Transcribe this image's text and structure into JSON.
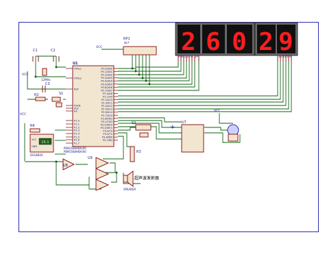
{
  "components": {
    "rp1": {
      "ref": "RP1",
      "value": "4k7"
    },
    "u1": {
      "ref": "U1",
      "part": "P89C668HBA/00",
      "subpart": "P89C668HBA/00"
    },
    "u7": {
      "ref": "U7"
    },
    "u8": {
      "ref": "U8"
    },
    "u9": {
      "ref": "U9"
    },
    "c1": {
      "ref": "C1"
    },
    "c2": {
      "ref": "C2"
    },
    "c3": {
      "ref": "C3"
    },
    "r2": {
      "ref": "R2"
    },
    "r3": {
      "ref": "R3"
    },
    "r6": {
      "ref": "R6"
    },
    "s1": {
      "ref": "S1"
    },
    "s2": {
      "ref": "S2"
    },
    "x1": {
      "value": "12MHz"
    },
    "ds18b20": {
      "ref": "DS18B20",
      "vcc": "VCC",
      "gnd": "GND",
      "reading": "26.1"
    },
    "speaker": {
      "label": "SPEAKER",
      "caption": "超声波发射器"
    },
    "vcc_labels": [
      "VCC",
      "VCC",
      "VCC",
      "VCC"
    ]
  },
  "display_left": {
    "digits": [
      "2",
      "6",
      "0"
    ],
    "pins": "ABCDEFG DP"
  },
  "display_right": {
    "digits": [
      "2",
      "9"
    ],
    "pins": "1234569"
  },
  "u1_pins_left": [
    "XTAL1",
    "XTAL2",
    "RST",
    "PSEN",
    "ALE",
    "EA",
    "P1.0",
    "P1.1",
    "P1.2",
    "P1.3",
    "P1.4",
    "P1.5",
    "P1.6",
    "P1.7"
  ],
  "u1_pins_right": [
    "P0.0/AD0",
    "P0.1/AD1",
    "P0.2/AD2",
    "P0.3/AD3",
    "P0.4/AD4",
    "P0.5/AD5",
    "P0.6/AD6",
    "P0.7/AD7",
    "P2.0/A8",
    "P2.1/A9",
    "P2.2/A10",
    "P2.3/A11",
    "P2.4/A12",
    "P2.5/A13",
    "P2.6/A14",
    "P2.7/A15",
    "P3.0/RXD",
    "P3.1/TXD",
    "P3.2/INT0",
    "P3.3/INT1",
    "P3.4/T0",
    "P3.5/T1",
    "P3.6/WR",
    "P3.7/RD"
  ],
  "colors": {
    "wire": "#0e5f0e",
    "component": "#8b1a1a",
    "body": "#f2e6d0",
    "frame": "#2b2bb5",
    "display_bg": "#101010",
    "segment_on": "#ff1d1d",
    "text": "#1a1a80"
  }
}
